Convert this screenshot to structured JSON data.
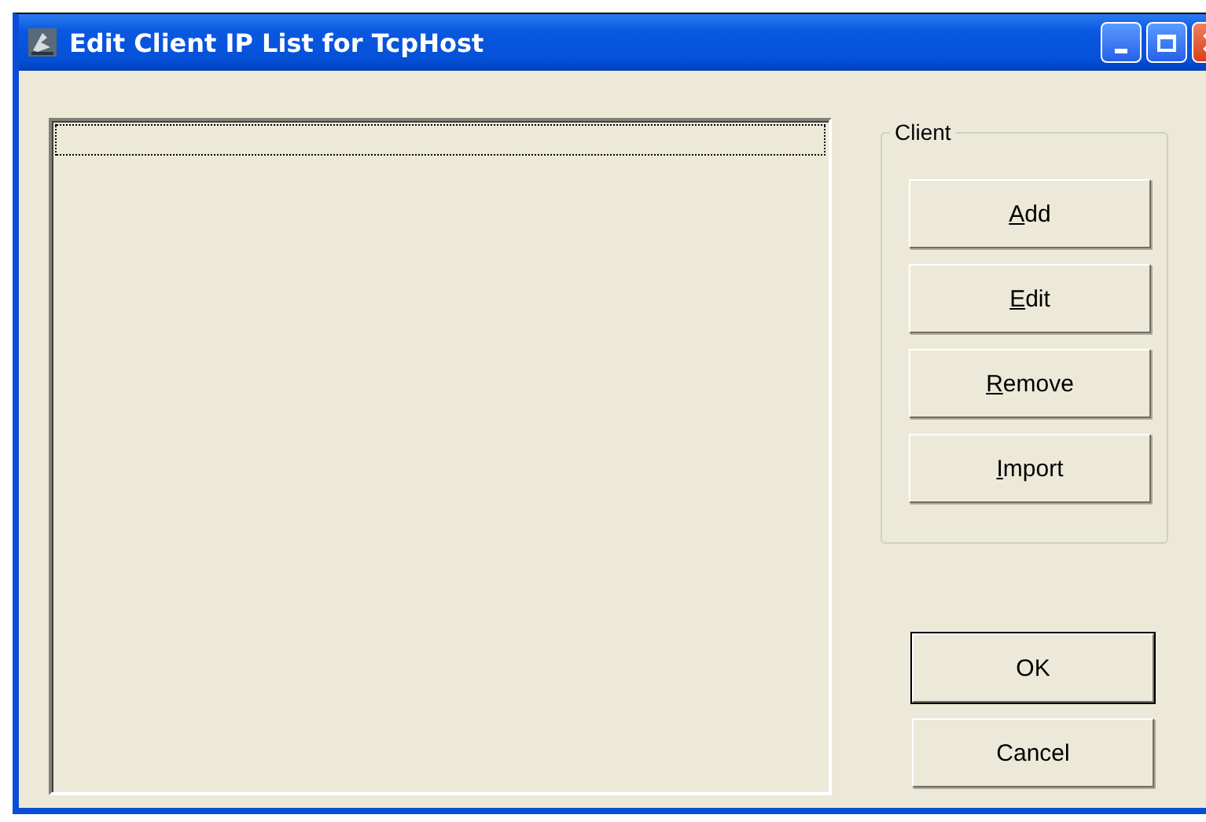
{
  "window": {
    "title": "Edit Client IP List for TcpHost"
  },
  "client_list": {
    "focused": true
  },
  "client_group": {
    "title": "Client",
    "buttons": [
      {
        "label": "Add",
        "mnemonic": true
      },
      {
        "label": "Edit",
        "mnemonic": true
      },
      {
        "label": "Remove",
        "mnemonic": true
      },
      {
        "label": "Import",
        "mnemonic": true
      }
    ]
  },
  "dialog_buttons": [
    {
      "label": "OK",
      "default": true
    },
    {
      "label": "Cancel",
      "default": false
    }
  ]
}
